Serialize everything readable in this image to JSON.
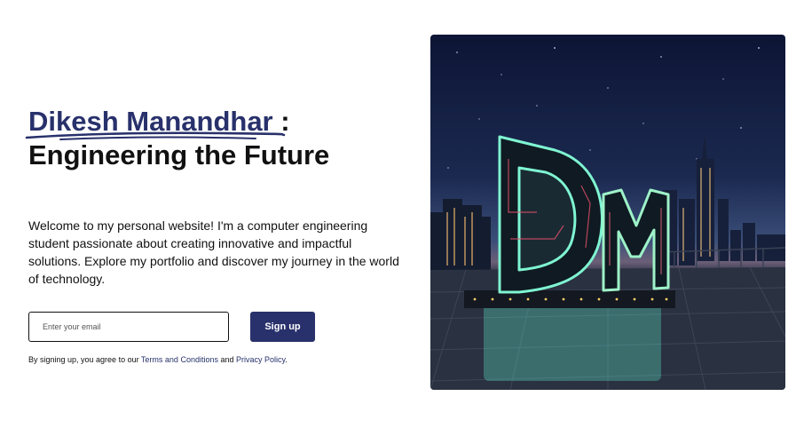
{
  "hero": {
    "name": "Dikesh Manandhar",
    "title_separator": " :",
    "tagline": "Engineering the Future",
    "intro": "Welcome to my personal website! I'm a computer engineering student passionate about creating innovative and impactful solutions. Explore my portfolio and discover my journey in the world of technology."
  },
  "signup": {
    "email_placeholder": "Enter your email",
    "button_label": "Sign up",
    "terms_prefix": "By signing up, you agree to our ",
    "terms_link": "Terms and Conditions",
    "terms_and": " and ",
    "privacy_link": "Privacy Policy",
    "terms_suffix": "."
  },
  "image": {
    "alt": "Neon DM letters on a city rooftop at night",
    "monogram": "DM"
  },
  "colors": {
    "brand": "#28316b",
    "text": "#111111",
    "background": "#ffffff"
  }
}
